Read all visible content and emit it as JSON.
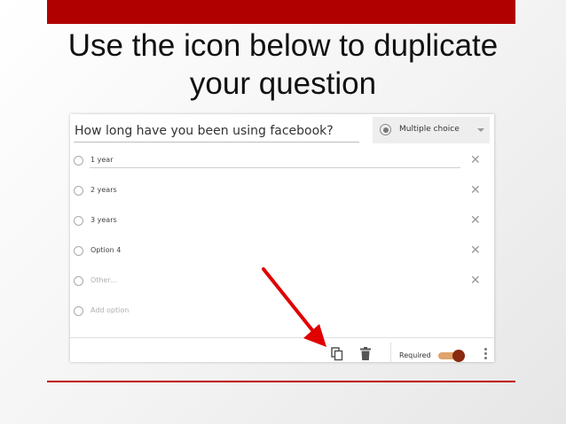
{
  "slide": {
    "title_line1": "Use the icon below to duplicate",
    "title_line2": "your question"
  },
  "question": {
    "title": "How long have you been using facebook?",
    "type_label": "Multiple choice"
  },
  "options": [
    {
      "label": "1 year"
    },
    {
      "label": "2 years"
    },
    {
      "label": "3 years"
    },
    {
      "label": "Option 4"
    },
    {
      "label": "Other..."
    },
    {
      "label": "Add option"
    }
  ],
  "footer": {
    "required_label": "Required",
    "required_on": true
  },
  "icons": {
    "remove": "close-icon",
    "duplicate": "duplicate-icon",
    "delete": "trash-icon",
    "more": "more-vert-icon",
    "pointer": "red-arrow"
  },
  "colors": {
    "accent_red": "#b00000",
    "toggle_track": "#e0a36b",
    "toggle_knob": "#8a2a10"
  }
}
